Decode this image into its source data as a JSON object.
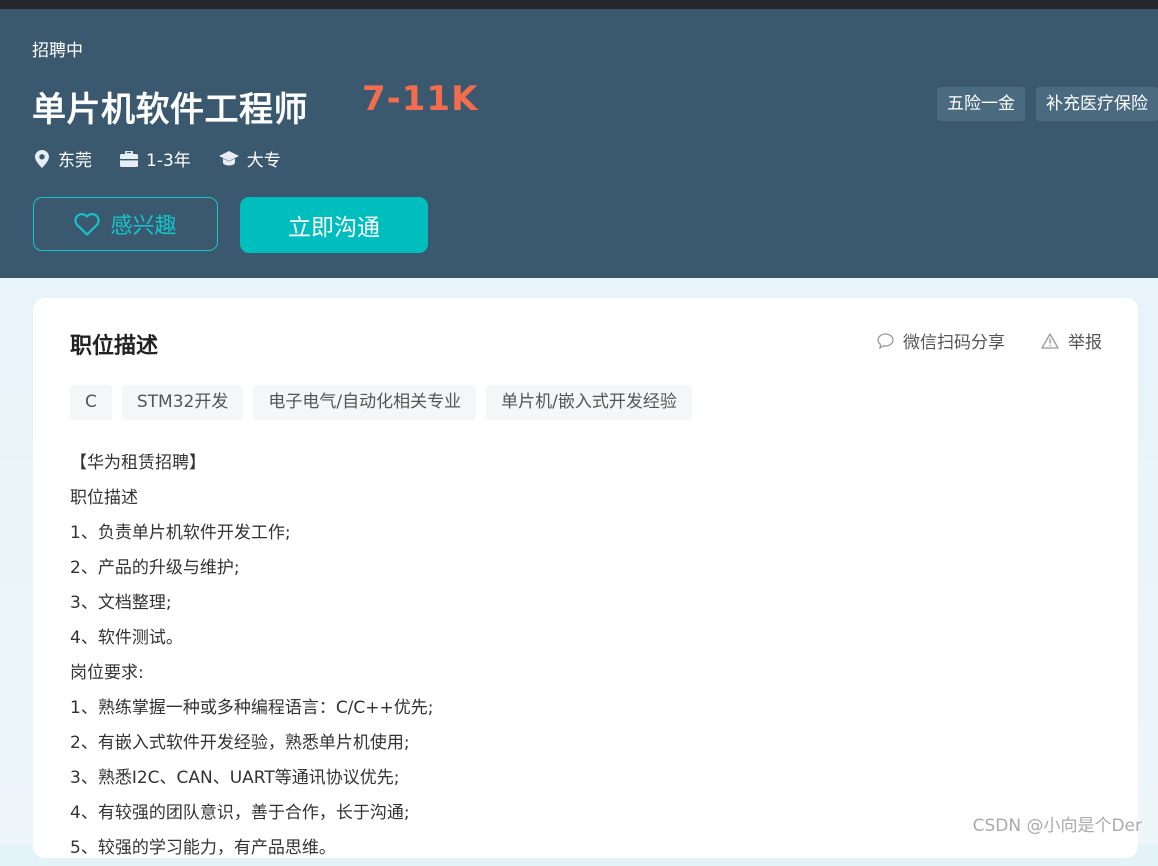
{
  "header": {
    "status": "招聘中",
    "title": "单片机软件工程师",
    "salary": "7-11K",
    "benefits": [
      "五险一金",
      "补充医疗保险"
    ],
    "meta": {
      "location": "东莞",
      "experience": "1-3年",
      "education": "大专"
    },
    "interest_label": "感兴趣",
    "chat_label": "立即沟通"
  },
  "card": {
    "title": "职位描述",
    "share_label": "微信扫码分享",
    "report_label": "举报",
    "tags": [
      "C",
      "STM32开发",
      "电子电气/自动化相关专业",
      "单片机/嵌入式开发经验"
    ],
    "description": [
      "【华为租赁招聘】",
      "职位描述",
      "1、负责单片机软件开发工作;",
      "2、产品的升级与维护;",
      "3、文档整理;",
      "4、软件测试。",
      "岗位要求:",
      "1、熟练掌握一种或多种编程语言：C/C++优先;",
      "2、有嵌入式软件开发经验，熟悉单片机使用;",
      "3、熟悉I2C、CAN、UART等通讯协议优先;",
      "4、有较强的团队意识，善于合作，长于沟通;",
      "5、较强的学习能力，有产品思维。"
    ]
  },
  "watermark": "CSDN @小向是个Der",
  "colors": {
    "banner": "#3a586e",
    "accent": "#00bebd",
    "salary": "#f26d4d"
  },
  "icons": {
    "location": "location-pin-icon",
    "experience": "briefcase-icon",
    "education": "graduation-cap-icon",
    "interest": "heart-icon",
    "share": "chat-bubble-icon",
    "report": "warning-icon"
  }
}
